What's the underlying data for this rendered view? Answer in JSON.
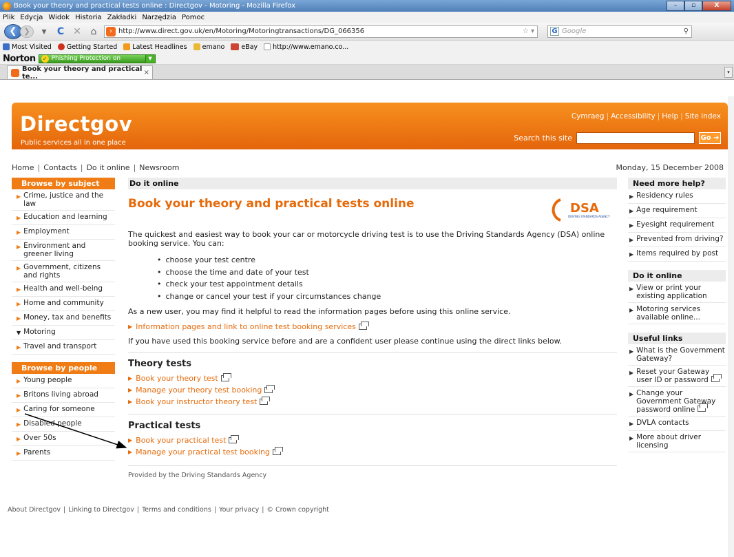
{
  "window": {
    "title": "Book your theory and practical tests online : Directgov - Motoring - Mozilla Firefox",
    "buttons": [
      "–",
      "▫",
      "X"
    ]
  },
  "menu": [
    "Plik",
    "Edycja",
    "Widok",
    "Historia",
    "Zakładki",
    "Narzędzia",
    "Pomoc"
  ],
  "nav": {
    "url": "http://www.direct.gov.uk/en/Motoring/Motoringtransactions/DG_066356",
    "search_placeholder": "Google"
  },
  "bookmarks": [
    {
      "label": "Most Visited",
      "color": "#3b6fc7"
    },
    {
      "label": "Getting Started",
      "color": "#d0301e"
    },
    {
      "label": "Latest Headlines",
      "color": "#f39a1e"
    },
    {
      "label": "emano",
      "color": "#e9b936"
    },
    {
      "label": "eBay",
      "color": "#c43"
    },
    {
      "label": "http://www.emano.co...",
      "color": "#ccc"
    }
  ],
  "norton": {
    "logo": "Norton",
    "phishing": "Phishing Protection on"
  },
  "tab": {
    "label": "Book your theory and practical te...",
    "close": "×"
  },
  "header": {
    "logo": "Directgov",
    "tagline": "Public services all in one place",
    "toplinks": [
      "Cymraeg",
      "Accessibility",
      "Help",
      "Site index"
    ],
    "search_label": "Search this site",
    "go": "Go"
  },
  "crumbs": [
    "Home",
    "Contacts",
    "Do it online",
    "Newsroom"
  ],
  "date": "Monday, 15 December 2008",
  "browse_subject": {
    "heading": "Browse by subject",
    "items": [
      "Crime, justice and the law",
      "Education and learning",
      "Employment",
      "Environment and greener living",
      "Government, citizens and rights",
      "Health and well-being",
      "Home and community",
      "Money, tax and benefits",
      "Motoring",
      "Travel and transport"
    ]
  },
  "browse_people": {
    "heading": "Browse by people",
    "items": [
      "Young people",
      "Britons living abroad",
      "Caring for someone",
      "Disabled people",
      "Over 50s",
      "Parents"
    ]
  },
  "main": {
    "section": "Do it online",
    "title": "Book your theory and practical tests online",
    "dsa_logo": "DSA",
    "dsa_sub": "DRIVING STANDARDS AGENCY",
    "intro": "The quickest and easiest way to book your car or motorcycle driving test is to use the Driving Standards Agency (DSA) online booking service. You can:",
    "bullets": [
      "choose your test centre",
      "choose the time and date of your test",
      "check your test appointment details",
      "change or cancel your test if your circumstances change"
    ],
    "new_user": "As a new user, you may find it helpful to read the information pages before using this online service.",
    "info_link": "Information pages and link to online test booking services",
    "confident": "If you have used this booking service before and are a confident user please continue using the direct links below.",
    "theory_title": "Theory tests",
    "theory_links": [
      "Book your theory test",
      "Manage your theory test booking",
      "Book your instructor theory test"
    ],
    "practical_title": "Practical tests",
    "practical_links": [
      "Book your practical test",
      "Manage your practical test booking"
    ],
    "provided": "Provided by the Driving Standards Agency"
  },
  "right": {
    "help_heading": "Need more help?",
    "help_items": [
      "Residency rules",
      "Age requirement",
      "Eyesight requirement",
      "Prevented from driving?",
      "Items required by post"
    ],
    "online_heading": "Do it online",
    "online_items": [
      "View or print your existing application",
      "Motoring services available online..."
    ],
    "useful_heading": "Useful links",
    "useful_items": [
      "What is the Government Gateway?",
      "Reset your Gateway user ID or password",
      "Change your Government Gateway password online",
      "DVLA contacts",
      "More about driver licensing"
    ]
  },
  "footer": [
    "About Directgov",
    "Linking to Directgov",
    "Terms and conditions",
    "Your privacy",
    "© Crown copyright"
  ],
  "colors": {
    "brand_orange": "#f07c15",
    "link_orange": "#e66a0a"
  }
}
